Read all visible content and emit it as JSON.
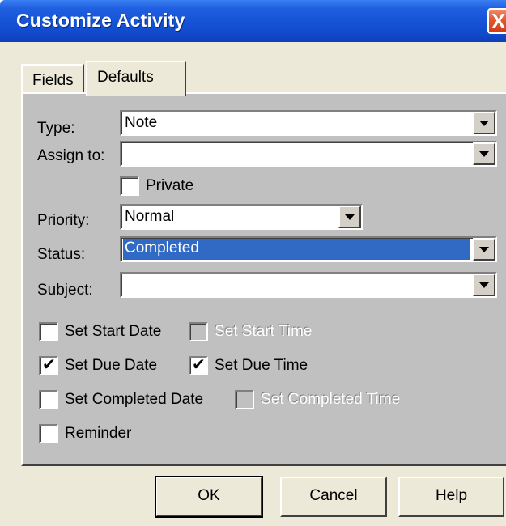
{
  "window": {
    "title": "Customize Activity",
    "close_glyph": "X"
  },
  "tabs": [
    {
      "label": "Fields",
      "active": false
    },
    {
      "label": "Defaults",
      "active": true
    }
  ],
  "form": {
    "type": {
      "label": "Type:",
      "value": "Note"
    },
    "assign_to": {
      "label": "Assign to:",
      "value": ""
    },
    "private": {
      "label": "Private",
      "checked": false
    },
    "priority": {
      "label": "Priority:",
      "value": "Normal"
    },
    "status": {
      "label": "Status:",
      "value": "Completed"
    },
    "subject": {
      "label": "Subject:",
      "value": ""
    }
  },
  "checkboxes": {
    "set_start_date": {
      "label": "Set Start Date",
      "checked": false,
      "enabled": true
    },
    "set_start_time": {
      "label": "Set Start Time",
      "checked": false,
      "enabled": false
    },
    "set_due_date": {
      "label": "Set Due Date",
      "checked": true,
      "enabled": true
    },
    "set_due_time": {
      "label": "Set Due Time",
      "checked": true,
      "enabled": true
    },
    "set_completed_date": {
      "label": "Set Completed Date",
      "checked": false,
      "enabled": true
    },
    "set_completed_time": {
      "label": "Set Completed Time",
      "checked": false,
      "enabled": false
    },
    "reminder": {
      "label": "Reminder",
      "checked": false,
      "enabled": true
    }
  },
  "tick_glyph": "✔",
  "buttons": {
    "ok": "OK",
    "cancel": "Cancel",
    "help": "Help"
  },
  "colors": {
    "title_bar": "#1552d6",
    "panel": "#c0c0c0",
    "dialog": "#ece9d8",
    "selection": "#316ac5",
    "close_button": "#d03c14"
  }
}
